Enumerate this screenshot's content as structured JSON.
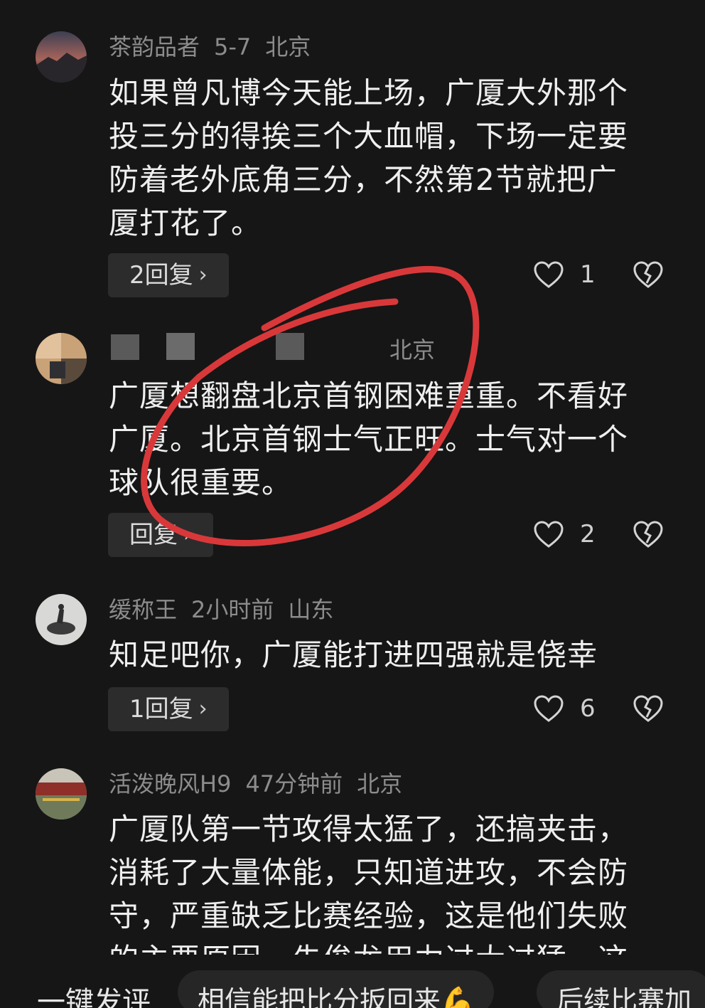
{
  "comments": [
    {
      "username": "茶韵品者",
      "time": "5-7",
      "location": "北京",
      "text": "如果曾凡博今天能上场，广厦大外那个\n投三分的得挨三个大血帽，下场一定要\n防着老外底角三分，不然第2节就把广\n厦打花了。",
      "reply_label": "2回复",
      "likes": "1"
    },
    {
      "username": "",
      "time": "",
      "location": "北京",
      "text": "广厦想翻盘北京首钢困难重重。不看好\n广厦。北京首钢士气正旺。士气对一个\n球队很重要。",
      "reply_label": "回复",
      "likes": "2"
    },
    {
      "username": "缓称王",
      "time": "2小时前",
      "location": "山东",
      "text": "知足吧你，广厦能打进四强就是侥幸",
      "reply_label": "1回复",
      "likes": "6"
    },
    {
      "username": "活泼晚风H9",
      "time": "47分钟前",
      "location": "北京",
      "text": "广厦队第一节攻得太猛了，还搞夹击，\n消耗了大量体能，只知道进攻，不会防\n守，严重缺乏比赛经验，这是他们失败\n的主要原因。朱俊龙用力过大过猛，这",
      "reply_label": "",
      "likes": ""
    }
  ],
  "quick_bar": {
    "label": "一键发评",
    "chips": [
      "相信能把比分扳回来💪",
      "后续比赛加"
    ]
  },
  "icons": {
    "like": "heart-outline-icon",
    "dislike": "broken-heart-icon",
    "chevron": "chevron-right-icon"
  },
  "colors": {
    "background": "#161616",
    "annotation": "#d9383a"
  }
}
